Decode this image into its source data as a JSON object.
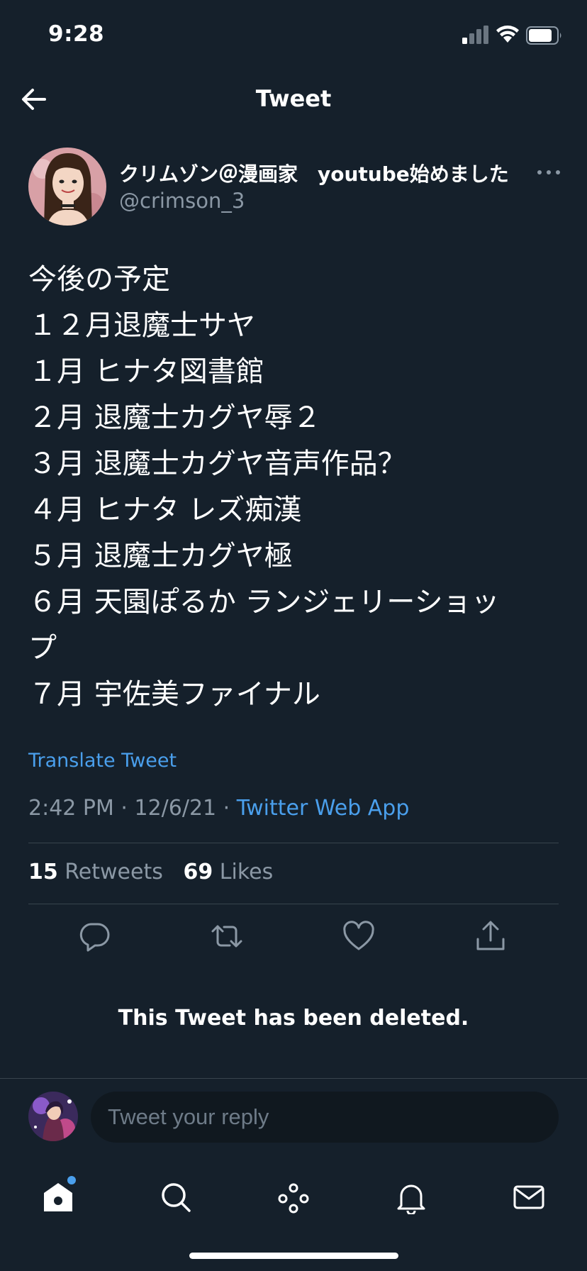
{
  "status_bar": {
    "time": "9:28"
  },
  "nav": {
    "title": "Tweet"
  },
  "tweet": {
    "display_name": "クリムゾン＠漫画家　youtube始めました",
    "handle": "@crimson_3",
    "lines": [
      "今後の予定",
      "１２月退魔士サヤ",
      "１月 ヒナタ図書館",
      "２月 退魔士カグヤ辱２",
      "３月 退魔士カグヤ音声作品？",
      "４月 ヒナタ レズ痴漢",
      "５月 退魔士カグヤ極",
      "６月 天園ぽるか ランジェリーショッ",
      "プ",
      "７月 宇佐美ファイナル"
    ],
    "translate_label": "Translate Tweet",
    "timestamp": "2:42 PM · 12/6/21 · ",
    "source": "Twitter Web App",
    "retweet_count": "15",
    "retweet_label": "Retweets",
    "like_count": "69",
    "like_label": "Likes"
  },
  "deleted_notice": "This Tweet has been deleted.",
  "reply": {
    "placeholder": "Tweet your reply"
  },
  "colors": {
    "background": "#15202b",
    "accent": "#4a9fec",
    "secondary_text": "#8b98a5",
    "divider": "#38444d"
  },
  "icons": {
    "back": "arrow-left-icon",
    "more": "more-horizontal-icon",
    "reply": "reply-icon",
    "retweet": "retweet-icon",
    "like": "heart-icon",
    "share": "share-icon",
    "home": "home-icon",
    "search": "search-icon",
    "spaces": "spaces-icon",
    "notifications": "bell-icon",
    "messages": "mail-icon"
  }
}
